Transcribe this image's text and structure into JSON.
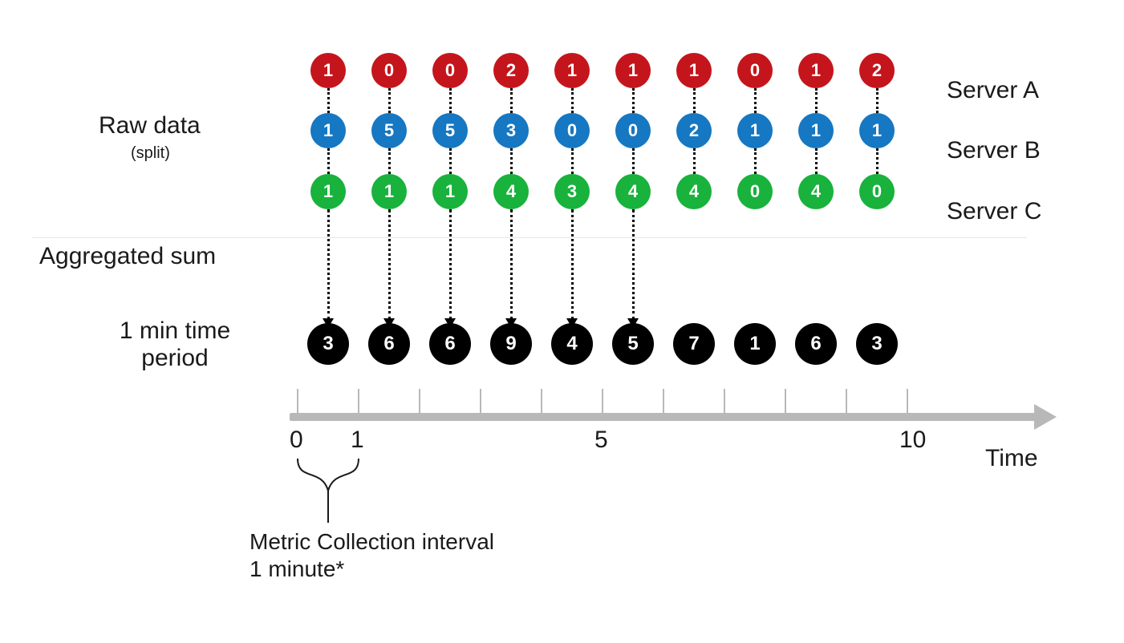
{
  "labels": {
    "raw_data": "Raw data",
    "split": "(split)",
    "aggregated": "Aggregated sum",
    "period_l1": "1 min time",
    "period_l2": "period",
    "time": "Time",
    "interval_l1": "Metric Collection interval",
    "interval_l2": "1 minute*",
    "tick0": "0",
    "tick1": "1",
    "tick5": "5",
    "tick10": "10"
  },
  "series": {
    "serverA": {
      "name": "Server A",
      "color": "#c5151c",
      "values": [
        1,
        0,
        0,
        2,
        1,
        1,
        1,
        0,
        1,
        2
      ]
    },
    "serverB": {
      "name": "Server B",
      "color": "#1677c2",
      "values": [
        1,
        5,
        5,
        3,
        0,
        0,
        2,
        1,
        1,
        1
      ]
    },
    "serverC": {
      "name": "Server C",
      "color": "#18b23c",
      "values": [
        1,
        1,
        1,
        4,
        3,
        4,
        4,
        0,
        4,
        0
      ]
    },
    "sum": {
      "name": "Aggregated sum",
      "color": "#000000",
      "values": [
        3,
        6,
        6,
        9,
        4,
        5,
        7,
        1,
        6,
        3
      ]
    }
  },
  "chart_data": {
    "type": "line",
    "title": "Metric aggregation over time (raw per-server data → aggregated sum)",
    "xlabel": "Time",
    "ylabel": "",
    "xlim": [
      0,
      10
    ],
    "x": [
      0,
      1,
      2,
      3,
      4,
      5,
      6,
      7,
      8,
      9
    ],
    "x_tick_labels_shown": [
      "0",
      "1",
      "5",
      "10"
    ],
    "series": [
      {
        "name": "Server A",
        "color": "#c5151c",
        "values": [
          1,
          0,
          0,
          2,
          1,
          1,
          1,
          0,
          1,
          2
        ]
      },
      {
        "name": "Server B",
        "color": "#1677c2",
        "values": [
          1,
          5,
          5,
          3,
          0,
          0,
          2,
          1,
          1,
          1
        ]
      },
      {
        "name": "Server C",
        "color": "#18b23c",
        "values": [
          1,
          1,
          1,
          4,
          3,
          4,
          4,
          0,
          4,
          0
        ]
      },
      {
        "name": "Aggregated sum (1 min)",
        "color": "#000000",
        "values": [
          3,
          6,
          6,
          9,
          4,
          5,
          7,
          1,
          6,
          3
        ]
      }
    ],
    "annotations": [
      "Metric Collection interval 1 minute*"
    ]
  },
  "layout": {
    "startX": 409,
    "stepX": 76,
    "rowY": {
      "A": 88,
      "B": 163,
      "C": 239,
      "sum": 407
    },
    "axisY": 520,
    "seriesLabelX": 1180,
    "arrowCount": 6
  }
}
